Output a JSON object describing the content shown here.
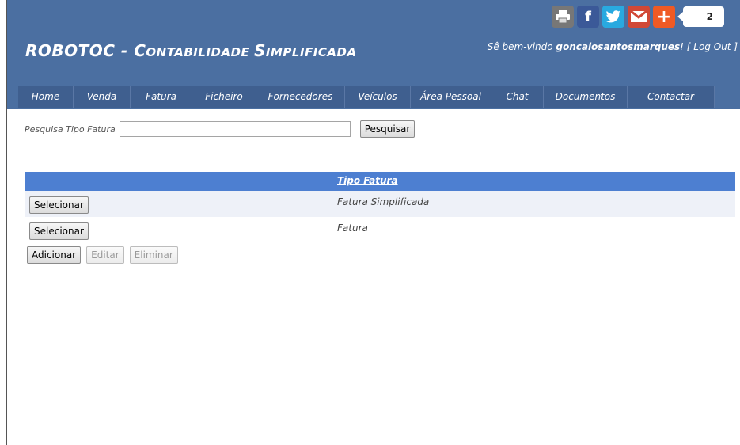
{
  "header": {
    "brand_main": "ROBOTOC - ",
    "brand_sc1_big": "C",
    "brand_sc1_small": "ontabilidade ",
    "brand_sc2_big": "S",
    "brand_sc2_small": "implificada",
    "welcome_prefix": "Sê bem-vindo ",
    "username": "goncalosantosmarques",
    "welcome_suffix": "! [ ",
    "logout_label": "Log Out",
    "logout_tail": " ]"
  },
  "share": {
    "print_icon": "printer-icon",
    "facebook_icon": "f",
    "twitter_icon": "twitter-bird-icon",
    "mail_icon": "gmail-icon",
    "plus_icon": "+",
    "count": "2"
  },
  "nav": {
    "items": [
      {
        "label": "Home"
      },
      {
        "label": "Venda"
      },
      {
        "label": "Fatura"
      },
      {
        "label": "Ficheiro"
      },
      {
        "label": "Fornecedores"
      },
      {
        "label": "Veículos"
      },
      {
        "label": "Área Pessoal"
      },
      {
        "label": "Chat"
      },
      {
        "label": "Documentos"
      },
      {
        "label": "Contactar"
      }
    ]
  },
  "search": {
    "label": "Pesquisa Tipo Fatura",
    "value": "",
    "button_label": "Pesquisar"
  },
  "table": {
    "column_header": "Tipo Fatura",
    "rows": [
      {
        "select_label": "Selecionar",
        "tipo": "Fatura Simplificada"
      },
      {
        "select_label": "Selecionar",
        "tipo": "Fatura"
      }
    ]
  },
  "actions": {
    "add_label": "Adicionar",
    "edit_label": "Editar",
    "delete_label": "Eliminar"
  },
  "colors": {
    "header_bg": "#4b6fa1",
    "nav_bg": "#3f5f8f",
    "table_header_bg": "#4d7fd1",
    "row_alt_bg": "#eef1f8"
  }
}
